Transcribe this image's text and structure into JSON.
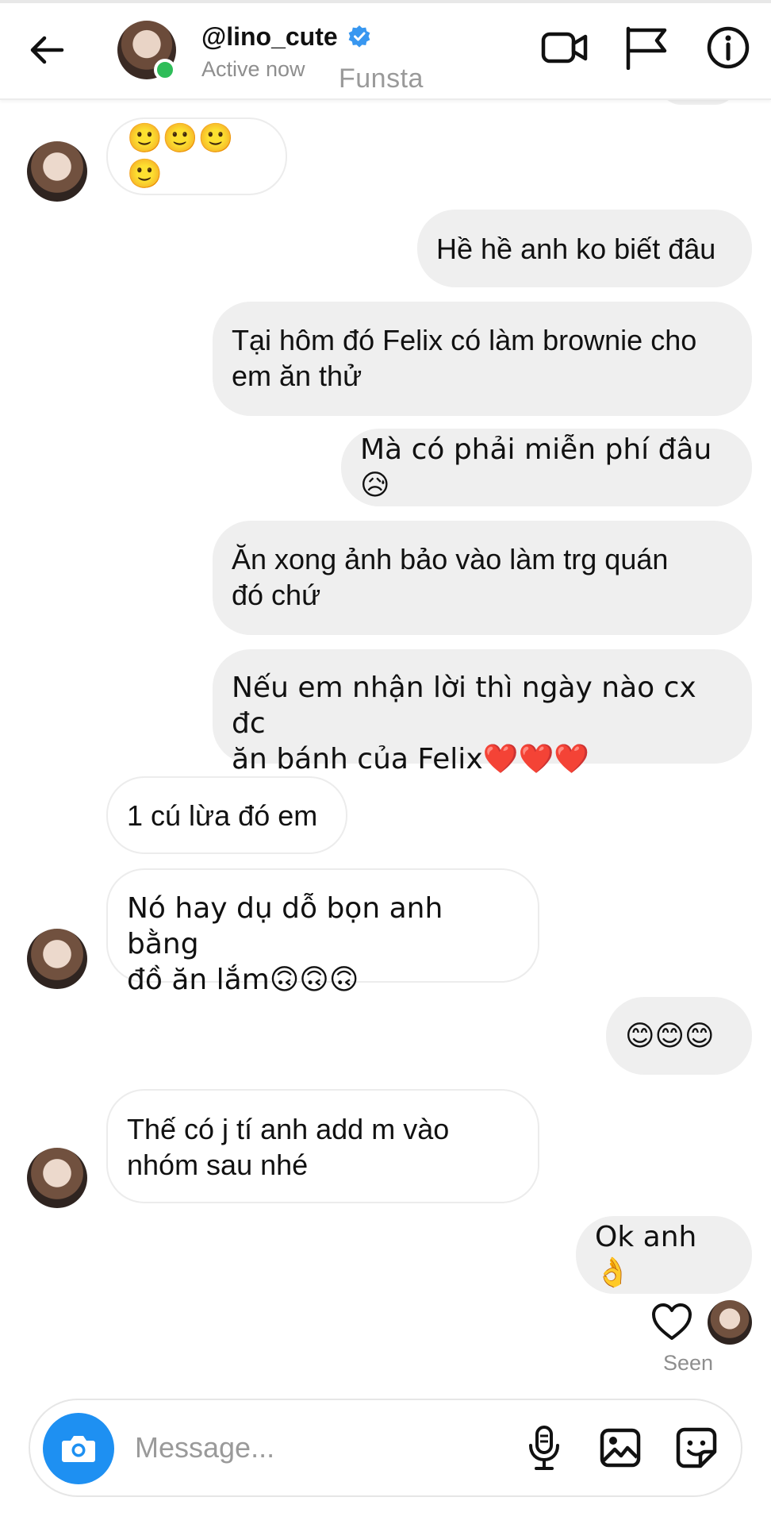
{
  "header": {
    "username": "@lino_cute",
    "status": "Active now",
    "account_label": "Funsta"
  },
  "messages": [
    {
      "side": "in",
      "text": "🙂🙂🙂🙂",
      "avatar": true
    },
    {
      "side": "out",
      "text": "Hề hề anh ko biết đâu"
    },
    {
      "side": "out",
      "line1": "Tại hôm đó Felix có làm brownie cho",
      "line2": "em ăn thử"
    },
    {
      "side": "out",
      "text": "Mà có phải miễn phí đâu😥"
    },
    {
      "side": "out",
      "line1": "Ăn xong ảnh bảo vào làm trg quán",
      "line2": "đó chứ"
    },
    {
      "side": "out",
      "line1": "Nếu em nhận lời thì ngày nào cx đc",
      "line2": "ăn bánh của Felix❤️❤️❤️"
    },
    {
      "side": "in",
      "text": "1 cú lừa đó em"
    },
    {
      "side": "in",
      "line1": "Nó hay dụ dỗ bọn anh bằng",
      "line2": "đồ ăn lắm🙃🙃🙃",
      "avatar": true
    },
    {
      "side": "out",
      "text": "😊😊😊"
    },
    {
      "side": "in",
      "line1": "Thế có j tí anh add m vào",
      "line2": "nhóm sau nhé",
      "avatar": true
    },
    {
      "side": "out",
      "text": "Ok anh 👌"
    }
  ],
  "receipt": {
    "seen_label": "Seen"
  },
  "composer": {
    "placeholder": "Message..."
  },
  "colors": {
    "online": "#2ebd59",
    "camera_button": "#1e90f2",
    "verified": "#3897f0",
    "outgoing_bubble": "#efefef"
  },
  "icons": [
    "back-arrow-icon",
    "verified-badge-icon",
    "video-call-icon",
    "flag-icon",
    "info-icon",
    "heart-icon",
    "camera-icon",
    "microphone-icon",
    "gallery-icon",
    "sticker-icon"
  ]
}
